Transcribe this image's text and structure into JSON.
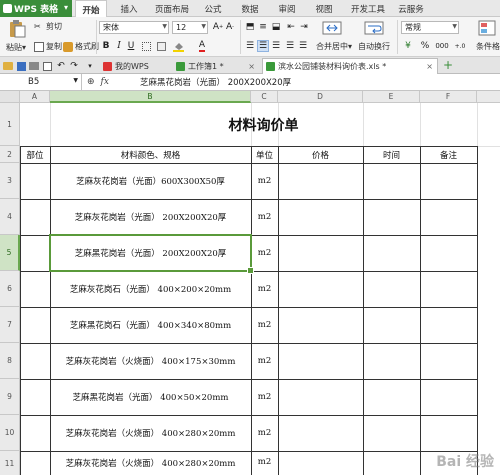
{
  "app": {
    "name": "WPS 表格"
  },
  "menu": [
    "开始",
    "插入",
    "页面布局",
    "公式",
    "数据",
    "审阅",
    "视图",
    "开发工具",
    "云服务"
  ],
  "ribbon": {
    "paste": "粘贴",
    "cut": "剪切",
    "copy": "复制",
    "format_painter": "格式刷",
    "font_name": "宋体",
    "font_size": "12",
    "merge_center": "合并居中",
    "wrap_text": "自动换行",
    "number_format": "常规",
    "condition_format": "条件格"
  },
  "tabs": [
    {
      "label": "我的WPS"
    },
    {
      "label": "工作簿1 *"
    },
    {
      "label": "滨水公园铺装材料询价表.xls *"
    }
  ],
  "formula_bar": {
    "cell_ref": "B5",
    "fx": "fx",
    "content": "芝麻黑花岗岩（光面）  200X200X20厚"
  },
  "columns": [
    "A",
    "B",
    "C",
    "D",
    "E",
    "F"
  ],
  "rows": [
    "1",
    "2",
    "3",
    "4",
    "5",
    "6",
    "7",
    "8",
    "9",
    "10",
    "11"
  ],
  "sheet": {
    "title": "材料询价单",
    "headers": [
      "部位",
      "材料颜色、规格",
      "单位",
      "价格",
      "时间",
      "备注"
    ],
    "items": [
      {
        "material": "芝麻灰花岗岩（光面）600X300X50厚",
        "unit": "m2"
      },
      {
        "material": "芝麻灰花岗岩（光面）  200X200X20厚",
        "unit": "m2"
      },
      {
        "material": "芝麻黑花岗岩（光面）  200X200X20厚",
        "unit": "m2"
      },
      {
        "material": "芝麻灰花岗石（光面）  400×200×20mm",
        "unit": "m2"
      },
      {
        "material": "芝麻黑花岗石（光面）  400×340×80mm",
        "unit": "m2"
      },
      {
        "material": "芝麻灰花岗岩（火烧面）  400×175×30mm",
        "unit": "m2"
      },
      {
        "material": "芝麻黑花岗岩（光面）  400×50×20mm",
        "unit": "m2"
      },
      {
        "material": "芝麻灰花岗岩（火烧面）  400×280×20mm",
        "unit": "m2"
      },
      {
        "material": "芝麻灰花岗岩（火烧面）  400×280×20mm",
        "unit": "m2"
      }
    ]
  },
  "watermark": "Bai 经验",
  "colors": {
    "wps_green": "#3a8e3a",
    "selection": "#5a9a3a"
  }
}
